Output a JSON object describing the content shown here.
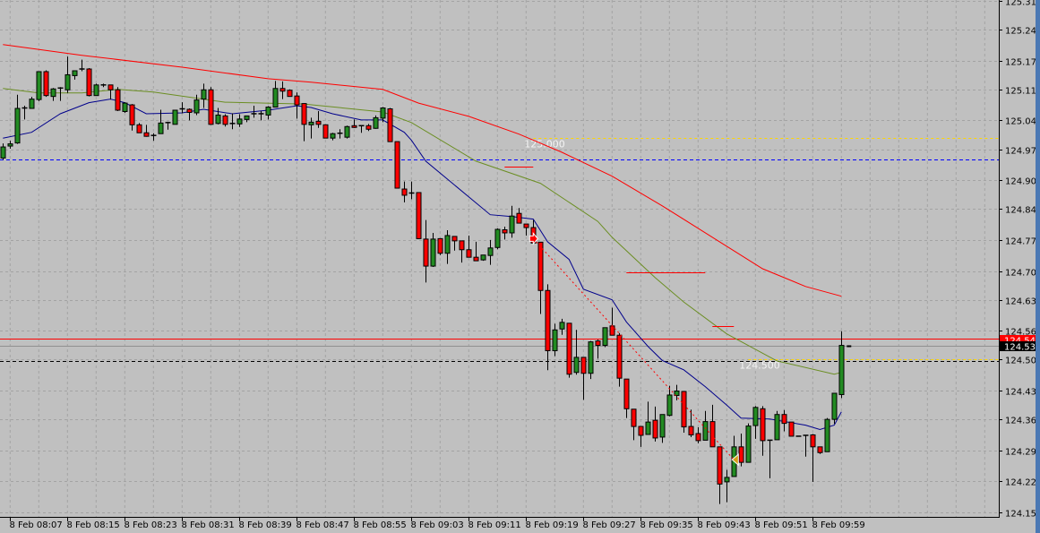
{
  "chart_data": {
    "type": "candlestick",
    "timeframe_note": "",
    "colors": {
      "background": "#c0c0c0",
      "grid": "#a3a3a3",
      "bull": "#228b22",
      "bear": "#ff0000",
      "wick": "#000000",
      "axis": "#000000"
    },
    "ylim": [
      124.155,
      125.31
    ],
    "y_ticks": [
      "125.310",
      "125.245",
      "125.175",
      "125.110",
      "125.040",
      "124.975",
      "124.905",
      "124.840",
      "124.770",
      "124.700",
      "124.635",
      "124.565",
      "124.500",
      "124.430",
      "124.365",
      "124.295",
      "124.225",
      "124.155"
    ],
    "time_labels": [
      "8 Feb 08:07",
      "8 Feb 08:15",
      "8 Feb 08:23",
      "8 Feb 08:31",
      "8 Feb 08:39",
      "8 Feb 08:47",
      "8 Feb 08:55",
      "8 Feb 09:03",
      "8 Feb 09:11",
      "8 Feb 09:19",
      "8 Feb 09:27",
      "8 Feb 09:35",
      "8 Feb 09:43",
      "8 Feb 09:51",
      "8 Feb 09:59"
    ],
    "candles_ohlc": [
      [
        124.955,
        124.988,
        124.951,
        124.98
      ],
      [
        124.982,
        124.994,
        124.976,
        124.987
      ],
      [
        124.989,
        125.098,
        124.987,
        125.067
      ],
      [
        125.067,
        125.073,
        125.042,
        125.068
      ],
      [
        125.067,
        125.093,
        125.066,
        125.088
      ],
      [
        125.087,
        125.151,
        125.083,
        125.15
      ],
      [
        125.15,
        125.153,
        125.093,
        125.096
      ],
      [
        125.094,
        125.113,
        125.084,
        125.111
      ],
      [
        125.112,
        125.115,
        125.084,
        125.113
      ],
      [
        125.109,
        125.184,
        125.102,
        125.143
      ],
      [
        125.141,
        125.153,
        125.132,
        125.152
      ],
      [
        125.155,
        125.177,
        125.151,
        125.156
      ],
      [
        125.156,
        125.158,
        125.094,
        125.096
      ],
      [
        125.096,
        125.123,
        125.096,
        125.12
      ],
      [
        125.119,
        125.123,
        125.115,
        125.12
      ],
      [
        125.12,
        125.12,
        125.087,
        125.109
      ],
      [
        125.109,
        125.115,
        125.061,
        125.063
      ],
      [
        125.06,
        125.081,
        125.057,
        125.079
      ],
      [
        125.075,
        125.077,
        125.017,
        125.03
      ],
      [
        125.03,
        125.034,
        125.012,
        125.012
      ],
      [
        125.012,
        125.03,
        125.003,
        125.004
      ],
      [
        125.005,
        125.011,
        124.994,
        125.006
      ],
      [
        125.01,
        125.064,
        125.01,
        125.034
      ],
      [
        125.034,
        125.037,
        125.019,
        125.035
      ],
      [
        125.031,
        125.063,
        125.031,
        125.063
      ],
      [
        125.065,
        125.081,
        125.056,
        125.066
      ],
      [
        125.065,
        125.067,
        125.04,
        125.058
      ],
      [
        125.057,
        125.098,
        125.052,
        125.086
      ],
      [
        125.088,
        125.123,
        125.068,
        125.109
      ],
      [
        125.109,
        125.115,
        125.03,
        125.031
      ],
      [
        125.033,
        125.068,
        125.031,
        125.052
      ],
      [
        125.05,
        125.054,
        125.026,
        125.031
      ],
      [
        125.032,
        125.056,
        125.02,
        125.033
      ],
      [
        125.032,
        125.054,
        125.025,
        125.043
      ],
      [
        125.042,
        125.05,
        125.036,
        125.05
      ],
      [
        125.054,
        125.073,
        125.046,
        125.055
      ],
      [
        125.054,
        125.061,
        125.04,
        125.055
      ],
      [
        125.052,
        125.072,
        125.042,
        125.07
      ],
      [
        125.07,
        125.129,
        125.07,
        125.112
      ],
      [
        125.112,
        125.128,
        125.088,
        125.106
      ],
      [
        125.108,
        125.11,
        125.094,
        125.094
      ],
      [
        125.095,
        125.103,
        125.044,
        125.075
      ],
      [
        125.078,
        125.079,
        124.993,
        125.031
      ],
      [
        125.03,
        125.046,
        124.999,
        125.036
      ],
      [
        125.038,
        125.061,
        125.023,
        125.031
      ],
      [
        125.03,
        125.031,
        125.0,
        125.0
      ],
      [
        125.0,
        125.012,
        124.995,
        125.01
      ],
      [
        125.01,
        125.02,
        124.999,
        125.011
      ],
      [
        125.002,
        125.028,
        124.999,
        125.026
      ],
      [
        125.028,
        125.042,
        125.023,
        125.024
      ],
      [
        125.027,
        125.028,
        125.012,
        125.028
      ],
      [
        125.028,
        125.032,
        125.016,
        125.02
      ],
      [
        125.022,
        125.051,
        125.021,
        125.046
      ],
      [
        125.045,
        125.07,
        125.036,
        125.068
      ],
      [
        125.066,
        125.068,
        124.992,
        124.992
      ],
      [
        124.992,
        124.992,
        124.887,
        124.887
      ],
      [
        124.885,
        124.902,
        124.855,
        124.871
      ],
      [
        124.876,
        124.902,
        124.862,
        124.875
      ],
      [
        124.877,
        124.877,
        124.772,
        124.773
      ],
      [
        124.772,
        124.815,
        124.674,
        124.711
      ],
      [
        124.711,
        124.786,
        124.709,
        124.772
      ],
      [
        124.773,
        124.774,
        124.736,
        124.74
      ],
      [
        124.74,
        124.792,
        124.716,
        124.78
      ],
      [
        124.778,
        124.778,
        124.746,
        124.768
      ],
      [
        124.768,
        124.768,
        124.719,
        124.748
      ],
      [
        124.748,
        124.78,
        124.731,
        124.731
      ],
      [
        124.731,
        124.766,
        124.723,
        124.723
      ],
      [
        124.725,
        124.736,
        124.723,
        124.736
      ],
      [
        124.735,
        124.77,
        124.714,
        124.752
      ],
      [
        124.753,
        124.796,
        124.749,
        124.794
      ],
      [
        124.793,
        124.8,
        124.771,
        124.786
      ],
      [
        124.786,
        124.847,
        124.775,
        124.824
      ],
      [
        124.83,
        124.842,
        124.808,
        124.808
      ],
      [
        124.806,
        124.806,
        124.78,
        124.798
      ],
      [
        124.798,
        124.815,
        124.763,
        124.763
      ],
      [
        124.765,
        124.765,
        124.603,
        124.656
      ],
      [
        124.656,
        124.67,
        124.476,
        124.52
      ],
      [
        124.52,
        124.581,
        124.508,
        124.567
      ],
      [
        124.569,
        124.592,
        124.556,
        124.584
      ],
      [
        124.582,
        124.582,
        124.459,
        124.467
      ],
      [
        124.471,
        124.567,
        124.466,
        124.505
      ],
      [
        124.505,
        124.505,
        124.409,
        124.469
      ],
      [
        124.469,
        124.542,
        124.456,
        124.54
      ],
      [
        124.542,
        124.545,
        124.502,
        124.532
      ],
      [
        124.532,
        124.572,
        124.528,
        124.572
      ],
      [
        124.576,
        124.617,
        124.555,
        124.555
      ],
      [
        124.555,
        124.56,
        124.439,
        124.458
      ],
      [
        124.456,
        124.456,
        124.368,
        124.389
      ],
      [
        124.388,
        124.388,
        124.318,
        124.349
      ],
      [
        124.349,
        124.349,
        124.303,
        124.329
      ],
      [
        124.331,
        124.405,
        124.331,
        124.359
      ],
      [
        124.363,
        124.394,
        124.315,
        124.323
      ],
      [
        124.325,
        124.376,
        124.312,
        124.376
      ],
      [
        124.374,
        124.441,
        124.372,
        124.42
      ],
      [
        124.419,
        124.443,
        124.408,
        124.429
      ],
      [
        124.428,
        124.428,
        124.335,
        124.348
      ],
      [
        124.349,
        124.387,
        124.325,
        124.33
      ],
      [
        124.333,
        124.347,
        124.311,
        124.317
      ],
      [
        124.318,
        124.384,
        124.318,
        124.36
      ],
      [
        124.36,
        124.398,
        124.303,
        124.303
      ],
      [
        124.303,
        124.303,
        124.174,
        124.219
      ],
      [
        124.224,
        124.251,
        124.178,
        124.234
      ],
      [
        124.236,
        124.328,
        124.236,
        124.303
      ],
      [
        124.303,
        124.333,
        124.259,
        124.268
      ],
      [
        124.268,
        124.356,
        124.268,
        124.35
      ],
      [
        124.351,
        124.395,
        124.321,
        124.392
      ],
      [
        124.389,
        124.395,
        124.283,
        124.317
      ],
      [
        124.317,
        124.318,
        124.232,
        124.318
      ],
      [
        124.319,
        124.384,
        124.319,
        124.376
      ],
      [
        124.376,
        124.386,
        124.338,
        124.356
      ],
      [
        124.359,
        124.359,
        124.327,
        124.327
      ],
      [
        124.327,
        124.327,
        124.326,
        124.327
      ],
      [
        124.329,
        124.329,
        124.281,
        124.329
      ],
      [
        124.33,
        124.332,
        124.224,
        124.303
      ],
      [
        124.303,
        124.303,
        124.287,
        124.29
      ],
      [
        124.292,
        124.368,
        124.292,
        124.365
      ],
      [
        124.365,
        124.424,
        124.355,
        124.424
      ],
      [
        124.421,
        124.564,
        124.413,
        124.532
      ]
    ],
    "moving_averages": [
      {
        "color": "#ff0000",
        "points": [
          [
            0,
            125.211
          ],
          [
            11,
            125.187
          ],
          [
            25,
            125.16
          ],
          [
            37,
            125.134
          ],
          [
            43,
            125.126
          ],
          [
            53,
            125.11
          ],
          [
            58,
            125.079
          ],
          [
            65,
            125.049
          ],
          [
            72,
            125.009
          ],
          [
            78,
            124.968
          ],
          [
            85,
            124.914
          ],
          [
            92,
            124.847
          ],
          [
            100,
            124.766
          ],
          [
            106,
            124.705
          ],
          [
            112,
            124.665
          ],
          [
            117,
            124.643
          ]
        ]
      },
      {
        "color": "#6b8e23",
        "points": [
          [
            0,
            125.112
          ],
          [
            5,
            125.102
          ],
          [
            11,
            125.102
          ],
          [
            16,
            125.11
          ],
          [
            21,
            125.104
          ],
          [
            31,
            125.081
          ],
          [
            42,
            125.077
          ],
          [
            53,
            125.059
          ],
          [
            57,
            125.035
          ],
          [
            66,
            124.948
          ],
          [
            75,
            124.898
          ],
          [
            83,
            124.812
          ],
          [
            85,
            124.776
          ],
          [
            91,
            124.685
          ],
          [
            95,
            124.63
          ],
          [
            101,
            124.558
          ],
          [
            108,
            124.497
          ],
          [
            116,
            124.467
          ],
          [
            117,
            124.471
          ]
        ]
      },
      {
        "color": "#00008b",
        "points": [
          [
            0,
            125.0
          ],
          [
            4,
            125.013
          ],
          [
            8,
            125.055
          ],
          [
            12,
            125.08
          ],
          [
            15,
            125.088
          ],
          [
            17,
            125.08
          ],
          [
            20,
            125.055
          ],
          [
            25,
            125.057
          ],
          [
            28,
            125.065
          ],
          [
            32,
            125.055
          ],
          [
            37,
            125.063
          ],
          [
            41,
            125.073
          ],
          [
            43,
            125.069
          ],
          [
            46,
            125.055
          ],
          [
            50,
            125.041
          ],
          [
            53,
            125.041
          ],
          [
            56,
            125.013
          ],
          [
            57,
            124.995
          ],
          [
            59,
            124.948
          ],
          [
            68,
            124.827
          ],
          [
            71,
            124.823
          ],
          [
            74,
            124.817
          ],
          [
            76,
            124.766
          ],
          [
            79,
            124.726
          ],
          [
            81,
            124.659
          ],
          [
            85,
            124.635
          ],
          [
            87,
            124.585
          ],
          [
            90,
            124.53
          ],
          [
            92,
            124.498
          ],
          [
            95,
            124.477
          ],
          [
            98,
            124.439
          ],
          [
            101,
            124.397
          ],
          [
            103,
            124.368
          ],
          [
            107,
            124.366
          ],
          [
            112,
            124.352
          ],
          [
            114,
            124.342
          ],
          [
            116,
            124.352
          ],
          [
            117,
            124.382
          ]
        ]
      }
    ],
    "horizontal_lines": [
      {
        "name": "level-125000",
        "price": 125.0,
        "color": "#ffd700",
        "style": "dotted",
        "from_bar": 74,
        "label": "125.000"
      },
      {
        "name": "level-124500",
        "price": 124.5,
        "color": "#ffd700",
        "style": "dotted",
        "from_bar": 104,
        "label": "124.500"
      },
      {
        "name": "blue-dashed-level",
        "price": 124.952,
        "color": "#0000ff",
        "style": "dashed"
      },
      {
        "name": "black-dashed-level",
        "price": 124.497,
        "color": "#000000",
        "style": "dashed"
      },
      {
        "name": "ask-line",
        "price": 124.547,
        "color": "#ff0000",
        "style": "solid"
      },
      {
        "name": "bid-line",
        "price": 124.532,
        "color": "#909090",
        "style": "solid"
      }
    ],
    "segments": [
      {
        "price": 124.936,
        "from_bar": 70,
        "to_bar": 74,
        "color": "#ff0000"
      },
      {
        "price": 124.697,
        "from_bar": 87,
        "to_bar": 98,
        "color": "#ff0000"
      },
      {
        "price": 124.576,
        "from_bar": 99,
        "to_bar": 102,
        "color": "#ff0000"
      }
    ],
    "trendline": {
      "from": [
        74,
        124.773
      ],
      "to": [
        102,
        124.274
      ],
      "color": "#ff0000",
      "style": "dotted"
    },
    "price_boxes": [
      {
        "value": "124.547",
        "color": "#ff0000"
      },
      {
        "value": "124.532",
        "color": "#000000"
      }
    ]
  }
}
